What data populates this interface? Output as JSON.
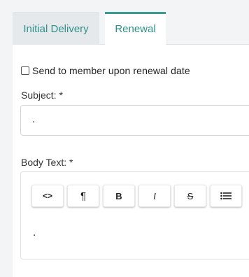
{
  "tabs": [
    {
      "label": "Initial Delivery"
    },
    {
      "label": "Renewal"
    }
  ],
  "renewal": {
    "send_checkbox_label": "Send to member upon renewal date",
    "subject_label": "Subject: *",
    "subject_value": ".",
    "body_label": "Body Text: *",
    "body_value": "."
  },
  "toolbar": {
    "code": "<>",
    "paragraph": "¶",
    "bold": "B",
    "italic": "I",
    "strike": "S"
  },
  "colors": {
    "accent": "#3a9a94",
    "tab_text": "#2f8f8a"
  }
}
